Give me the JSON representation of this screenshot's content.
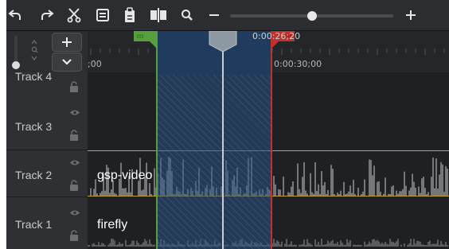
{
  "toolbar": {
    "icons": [
      "undo-icon",
      "redo-icon",
      "cut-icon",
      "copy-icon",
      "paste-icon",
      "split-icon",
      "zoom-icon",
      "zoom-out-icon",
      "zoom-in-icon"
    ],
    "zoom_level": 0.5
  },
  "ruler": {
    "playhead_time": "0:00:26;20",
    "labels": [
      ";00",
      "0:00:30;00"
    ]
  },
  "tracks": [
    {
      "label": "Track 4",
      "clip": ""
    },
    {
      "label": "Track 3",
      "clip": ""
    },
    {
      "label": "Track 2",
      "clip": "gsp-video"
    },
    {
      "label": "Track 1",
      "clip": "firefly"
    }
  ],
  "colors": {
    "in_marker": "#55a03c",
    "out_marker": "#c0322b",
    "playhead": "#9aa3ad",
    "clip_border": "#c8a033",
    "selection": "#1f3c5e"
  }
}
